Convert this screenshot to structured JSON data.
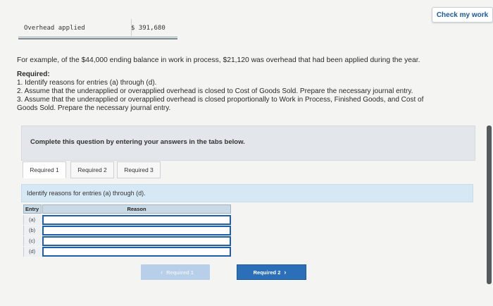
{
  "header": {
    "check_button": "Check my work"
  },
  "overhead": {
    "label": "Overhead applied",
    "value": "$ 391,680"
  },
  "text": {
    "example": "For example, of the $44,000 ending balance in work in process, $21,120 was overhead that had been applied during the year.",
    "required_heading": "Required:",
    "req1": "1. Identify reasons for entries (a) through (d).",
    "req2": "2. Assume that the underapplied or overapplied overhead is closed to Cost of Goods Sold. Prepare the necessary journal entry.",
    "req3a": "3. Assume that the underapplied or overapplied overhead is closed proportionally to Work in Process, Finished Goods, and Cost of",
    "req3b": "Goods Sold. Prepare the necessary journal entry."
  },
  "panel": {
    "complete_text": "Complete this question by entering your answers in the tabs below."
  },
  "tabs": [
    {
      "label": "Required 1"
    },
    {
      "label": "Required 2"
    },
    {
      "label": "Required 3"
    }
  ],
  "instruction": "Identify reasons for entries (a) through (d).",
  "table": {
    "headers": {
      "entry": "Entry",
      "reason": "Reason"
    },
    "rows": [
      {
        "entry": "(a)",
        "reason": ""
      },
      {
        "entry": "(b)",
        "reason": ""
      },
      {
        "entry": "(c)",
        "reason": ""
      },
      {
        "entry": "(d)",
        "reason": ""
      }
    ]
  },
  "nav": {
    "prev_label": "Required 1",
    "next_label": "Required 2",
    "prev_icon": "chevron-left-icon",
    "next_icon": "chevron-right-icon"
  },
  "colors": {
    "accent": "#2a6fb8",
    "link": "#1a5a9c",
    "instruction_bg": "#d6e8f3"
  }
}
